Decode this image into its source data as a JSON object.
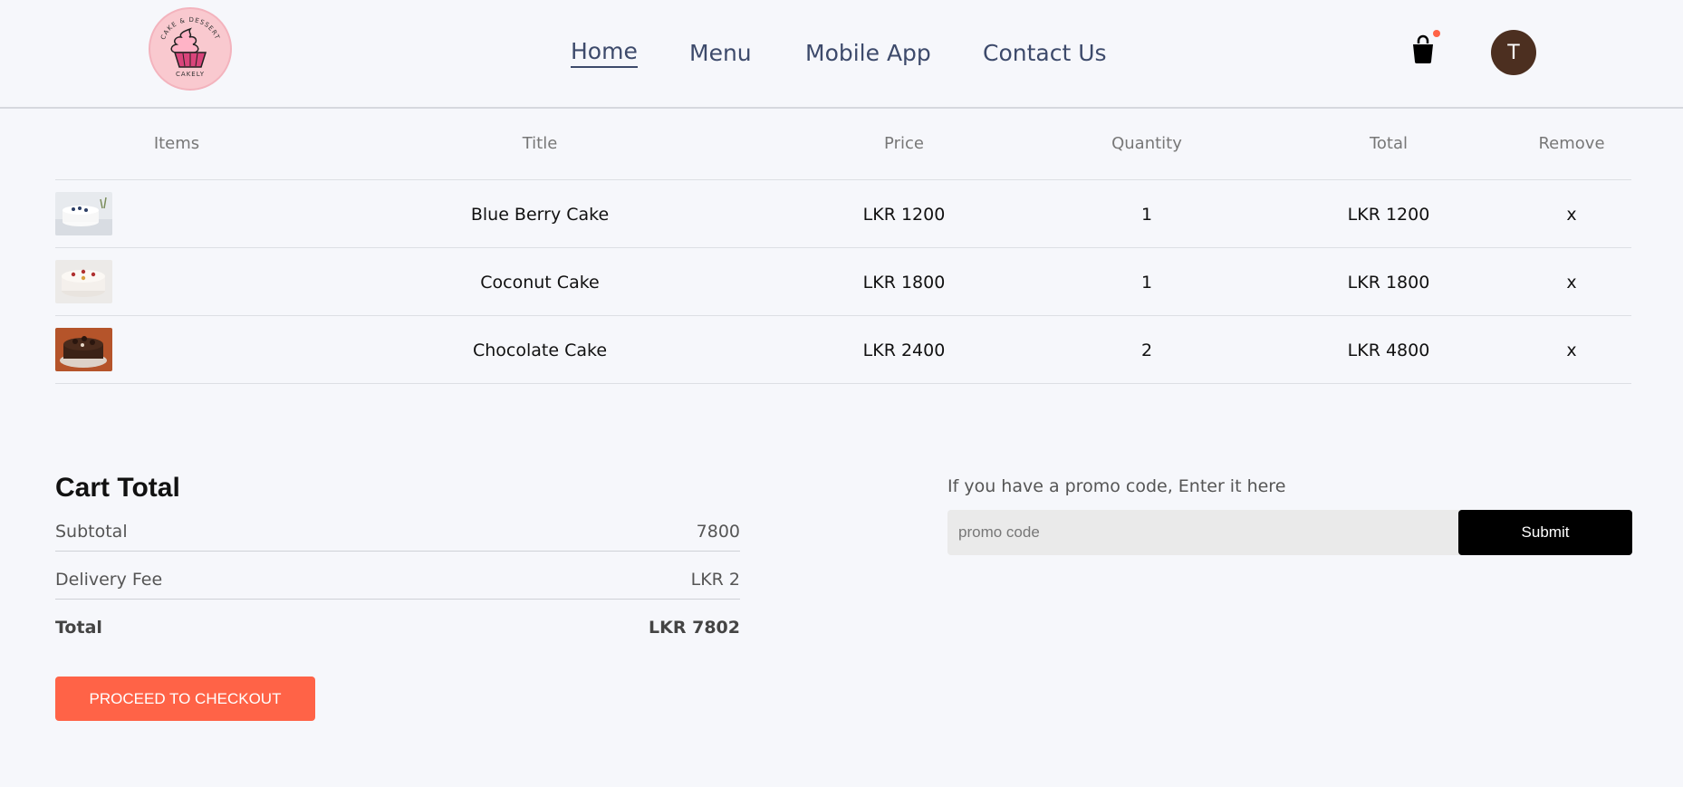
{
  "header": {
    "logo_text_top": "CAKE & DESSERT",
    "logo_text_bottom": "CAKELY",
    "nav": [
      {
        "label": "Home",
        "active": true
      },
      {
        "label": "Menu",
        "active": false
      },
      {
        "label": "Mobile App",
        "active": false
      },
      {
        "label": "Contact Us",
        "active": false
      }
    ],
    "avatar_initial": "T",
    "accent": "#ff6347"
  },
  "cart": {
    "columns": [
      "Items",
      "Title",
      "Price",
      "Quantity",
      "Total",
      "Remove"
    ],
    "rows": [
      {
        "title": "Blue Berry Cake",
        "price": "LKR 1200",
        "quantity": "1",
        "total": "LKR 1200",
        "remove": "x"
      },
      {
        "title": "Coconut Cake",
        "price": "LKR 1800",
        "quantity": "1",
        "total": "LKR 1800",
        "remove": "x"
      },
      {
        "title": "Chocolate Cake",
        "price": "LKR 2400",
        "quantity": "2",
        "total": "LKR 4800",
        "remove": "x"
      }
    ]
  },
  "cart_total": {
    "heading": "Cart Total",
    "subtotal_label": "Subtotal",
    "subtotal_value": "7800",
    "delivery_label": "Delivery Fee",
    "delivery_value": "LKR 2",
    "total_label": "Total",
    "total_value": "LKR 7802",
    "checkout_label": "PROCEED TO CHECKOUT"
  },
  "promo": {
    "label": "If you have a promo code, Enter it here",
    "placeholder": "promo code",
    "value": "",
    "submit_label": "Submit"
  }
}
